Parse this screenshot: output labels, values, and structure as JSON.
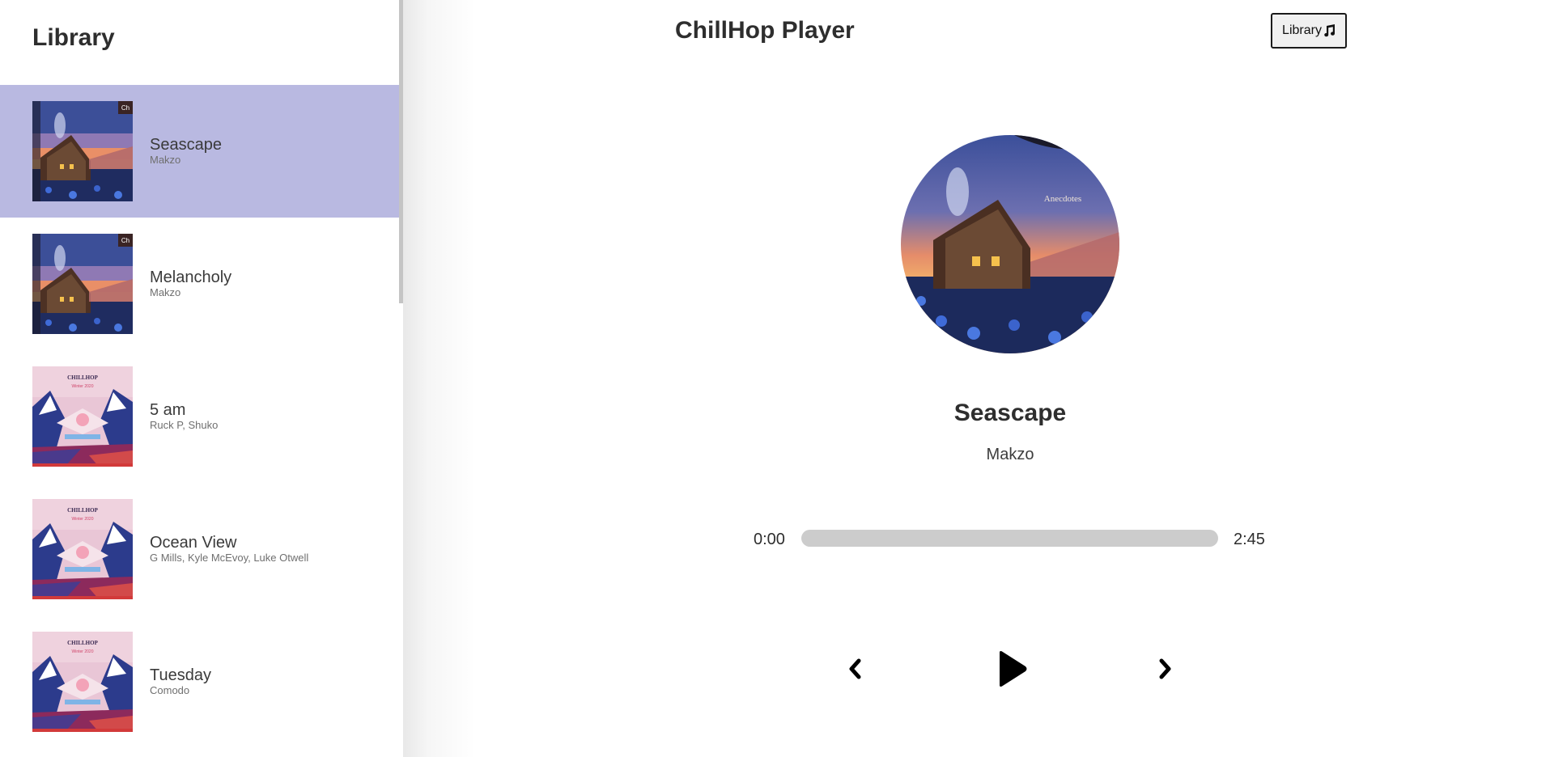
{
  "library": {
    "title": "Library",
    "songs": [
      {
        "name": "Seascape",
        "artist": "Makzo",
        "cover": "anecdotes-art",
        "selected": true
      },
      {
        "name": "Melancholy",
        "artist": "Makzo",
        "cover": "anecdotes-art",
        "selected": false
      },
      {
        "name": "5 am",
        "artist": "Ruck P, Shuko",
        "cover": "winter-2020-art",
        "selected": false
      },
      {
        "name": "Ocean View",
        "artist": "G Mills, Kyle McEvoy, Luke Otwell",
        "cover": "winter-2020-art",
        "selected": false
      },
      {
        "name": "Tuesday",
        "artist": "Comodo",
        "cover": "winter-2020-art",
        "selected": false
      }
    ]
  },
  "header": {
    "title": "ChillHop Player",
    "library_button_label": "Library",
    "library_button_icon": "music-note-icon"
  },
  "player": {
    "song_name": "Seascape",
    "artist": "Makzo",
    "current_time": "0:00",
    "duration": "2:45",
    "progress": 0,
    "cover_caption": "Anecdotes",
    "controls": {
      "prev_icon": "chevron-left-icon",
      "play_icon": "play-icon",
      "next_icon": "chevron-right-icon"
    }
  },
  "colors": {
    "selected_row": "#b9b9e1",
    "track": "#cccccc",
    "text": "#2e2e2e"
  }
}
